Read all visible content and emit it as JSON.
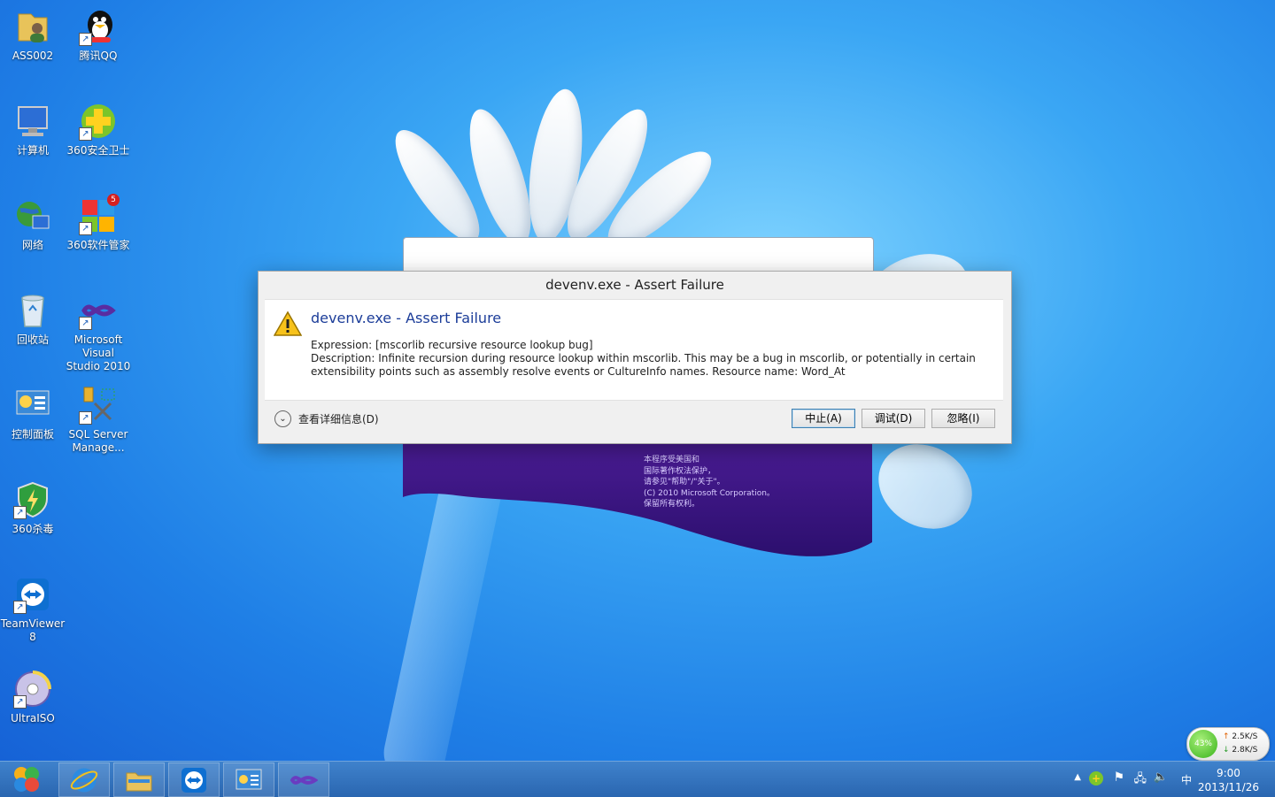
{
  "desktop_icons": [
    {
      "label": "ASS002",
      "icon": "folder-user-icon"
    },
    {
      "label": "腾讯QQ",
      "icon": "qq-penguin-icon"
    },
    {
      "label": "计算机",
      "icon": "computer-icon"
    },
    {
      "label": "360安全卫士",
      "icon": "360-safe-icon"
    },
    {
      "label": "网络",
      "icon": "network-icon"
    },
    {
      "label": "360软件管家",
      "icon": "360-software-icon"
    },
    {
      "label": "回收站",
      "icon": "recycle-bin-icon"
    },
    {
      "label": "Microsoft Visual Studio 2010",
      "icon": "visual-studio-icon"
    },
    {
      "label": "控制面板",
      "icon": "control-panel-icon"
    },
    {
      "label": "SQL Server Manage...",
      "icon": "sql-server-icon"
    },
    {
      "label": "360杀毒",
      "icon": "360-antivirus-icon"
    },
    {
      "label": "TeamViewer 8",
      "icon": "teamviewer-icon"
    },
    {
      "label": "UltraISO",
      "icon": "ultraiso-icon"
    }
  ],
  "badge_360_software": "5",
  "splash": {
    "legal_text": "本程序受美国和\n国际著作权法保护，\n请参见\"帮助\"/\"关于\"。\n(C) 2010 Microsoft Corporation。\n保留所有权利。"
  },
  "dialog": {
    "window_title": "devenv.exe - Assert Failure",
    "heading": "devenv.exe - Assert Failure",
    "expression": "Expression: [mscorlib recursive resource lookup bug]",
    "description": "Description: Infinite recursion during resource lookup within mscorlib.  This may be a bug in mscorlib, or potentially in certain extensibility points such as assembly resolve events or CultureInfo names.  Resource name: Word_At",
    "details_label": "查看详细信息(D)",
    "buttons": {
      "abort": "中止(A)",
      "debug": "调试(D)",
      "ignore": "忽略(I)"
    }
  },
  "taskbar": {
    "pinned": [
      "start-orb-icon",
      "internet-explorer-icon",
      "file-explorer-icon",
      "teamviewer-icon",
      "control-panel-icon",
      "visual-studio-icon"
    ],
    "clock_time": "9:00",
    "clock_date": "2013/11/26",
    "ime": "中"
  },
  "net_widget": {
    "percent": "43%",
    "upload": "2.5K/S",
    "download": "2.8K/S"
  },
  "colors": {
    "dialog_heading": "#1c3d99",
    "taskbar": "#2f6fbc",
    "splash_purple": "#3a157f"
  }
}
